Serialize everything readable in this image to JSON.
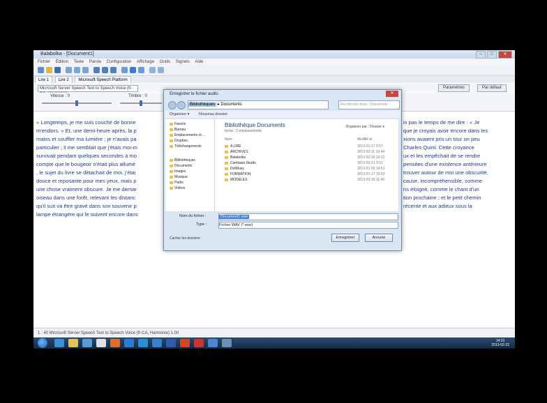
{
  "window": {
    "title": "Balabolka - [Document1]"
  },
  "menu": [
    "Fichier",
    "Édition",
    "Texte",
    "Parole",
    "Configuration",
    "Affichage",
    "Outils",
    "Signets",
    "Aide"
  ],
  "tabs": [
    "Lire 1",
    "Lire 2",
    "Microsoft Speech Platform"
  ],
  "voice": {
    "selected": "Microsoft Server Speech Text to Speech Voice (fr-CA, Harmonie)",
    "btn_settings": "Paramètres",
    "btn_default": "Par défaut"
  },
  "sliders": {
    "rate_label": "Vitesse :  0",
    "pitch_label": "Timbre :  0"
  },
  "document": {
    "lines": [
      "« Longtemps, je me suis couché de bonne",
      "m'endors. » Et, une demi-heure après, la p",
      "mains et souffler ma lumière ; je n'avais pa",
      "particulier ; il me semblait que j'étais moi-m",
      "survivait pendant quelques secondes à mo",
      "compte que le bougeoir n'était plus allumé",
      ", le sujet du livre se détachait de moi, j'étai",
      "douce et reposante pour mes yeux, mais p",
      "une chose vraiment obscure. Je me demar",
      "oiseau dans une forêt, relevant les distanc",
      "qu'il suit va être gravé dans son souvenir p",
      "lampe étrangère qui le suivent encore dans"
    ],
    "lines_right": [
      "is pas le temps de me dire : « Je",
      "que je croyais avoir encore dans les",
      "xions avaient pris un tour un peu",
      "Charles Quint. Cette croyance",
      "ux et les empêchait de se rendre",
      "pensées d'une existence antérieure",
      "trouver autour de moi une obscurité,",
      "cause, incompréhensible, comme",
      "ns éloigné, comme le chant d'un",
      "tion prochaine ; et le petit chemin",
      "récente et aux adieux sous la",
      ""
    ]
  },
  "dialog": {
    "title": "Enregistrer le fichier audio",
    "path": [
      "Bibliothèques",
      "Documents"
    ],
    "search_placeholder": "Rechercher dans : Documents",
    "organize": "Organiser ▾",
    "new_folder": "Nouveau dossier",
    "nav_items": [
      "Favoris",
      "Bureau",
      "Emplacements ré…",
      "Dropbox",
      "Téléchargements",
      "",
      "Bibliothèques",
      "Documents",
      "Images",
      "Musique",
      "Partis",
      "Vidéos"
    ],
    "library_title": "Bibliothèque Documents",
    "library_sub": "Inclut : 2 emplacements",
    "arrange": "Organiser par : Dossier ▾",
    "col_name": "Nom",
    "col_date": "Modifié le",
    "files": [
      {
        "name": "A LIRE",
        "date": "2013-01-17 9:57"
      },
      {
        "name": "ARCHIVES",
        "date": "2013-02-11 10:44"
      },
      {
        "name": "Balabolka",
        "date": "2013-02-20 16:22"
      },
      {
        "name": "Camtasia Studio",
        "date": "2013-02-21 9:12"
      },
      {
        "name": "DotMusy",
        "date": "2013-01-09 14:51"
      },
      {
        "name": "FORMATION",
        "date": "2013-01-17 10:03"
      },
      {
        "name": "MODELES",
        "date": "2013-02-18 11:40"
      }
    ],
    "filename_label": "Nom du fichier :",
    "filename_value": "Document1.wav",
    "type_label": "Type :",
    "type_value": "Fichier WAV (*.wav)",
    "hide_folders": "Cacher les dossiers",
    "save": "Enregistrer",
    "cancel": "Annuler"
  },
  "statusbar": {
    "text": "1 : 40      Microsoft Server Speech Text to Speech Voice (fr-CA, Harmonie)   1.00"
  },
  "taskbar": {
    "clock_time": "14:21",
    "clock_date": "2013-02-22"
  }
}
